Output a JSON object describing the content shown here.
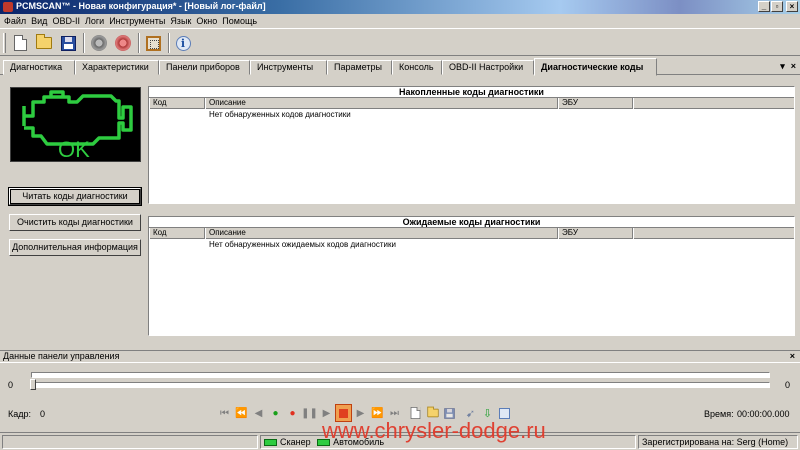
{
  "window": {
    "title": "PCMSCAN™ - Новая конфигурация* - [Новый лог-файл]",
    "buttons": [
      "_",
      "▫",
      "×"
    ]
  },
  "menu": [
    "Файл",
    "Вид",
    "OBD-II",
    "Логи",
    "Инструменты",
    "Язык",
    "Окно",
    "Помощь"
  ],
  "toolbar": {
    "icons": [
      "new-file-icon",
      "open-folder-icon",
      "save-disk-icon",
      "connect-icon",
      "disconnect-icon",
      "frame-icon",
      "info-icon"
    ],
    "info_glyph": "i"
  },
  "tabs": [
    {
      "label": "Диагностика",
      "active": false
    },
    {
      "label": "Характеристики",
      "active": false
    },
    {
      "label": "Панели приборов",
      "active": false
    },
    {
      "label": "Инструменты",
      "active": false
    },
    {
      "label": "Параметры",
      "active": false
    },
    {
      "label": "Консоль",
      "active": false
    },
    {
      "label": "OBD-II Настройки",
      "active": false
    },
    {
      "label": "Диагностические коды",
      "active": true
    }
  ],
  "tab_tools": [
    "▾",
    "×"
  ],
  "check_engine": {
    "status": "OK",
    "color": "#2ecc40"
  },
  "left_buttons": {
    "read": "Читать коды диагностики",
    "clear": "Очистить коды диагностики",
    "more": "Дополнительная информация"
  },
  "stored_codes": {
    "title": "Накопленные коды диагностики",
    "columns": [
      "Код",
      "Описание",
      "ЭБУ"
    ],
    "empty_message": "Нет обнаруженных кодов диагностики"
  },
  "pending_codes": {
    "title": "Ожидаемые коды диагностики",
    "columns": [
      "Код",
      "Описание",
      "ЭБУ"
    ],
    "empty_message": "Нет обнаруженных ожидаемых кодов диагностики"
  },
  "dashboard": {
    "title": "Данные панели управления",
    "close": "×",
    "slider_min": "0",
    "slider_max": "0",
    "slider_value": 0,
    "frame_label": "Кадр:",
    "frame_value": "0",
    "time_label": "Время:",
    "time_value": "00:00:00.000"
  },
  "player": {
    "first": "⏮",
    "prev_fast": "⏪",
    "prev": "◀",
    "go": "●",
    "record": "●",
    "pause": "❚❚",
    "play": "▶",
    "next": "▶",
    "next_fast": "⏩",
    "last": "⏭"
  },
  "status": {
    "scanner": "Сканер",
    "vehicle": "Автомобиль",
    "registered": "Зарегистрирована на: Serg (Home)"
  },
  "watermark": "www.chrysler-dodge.ru"
}
